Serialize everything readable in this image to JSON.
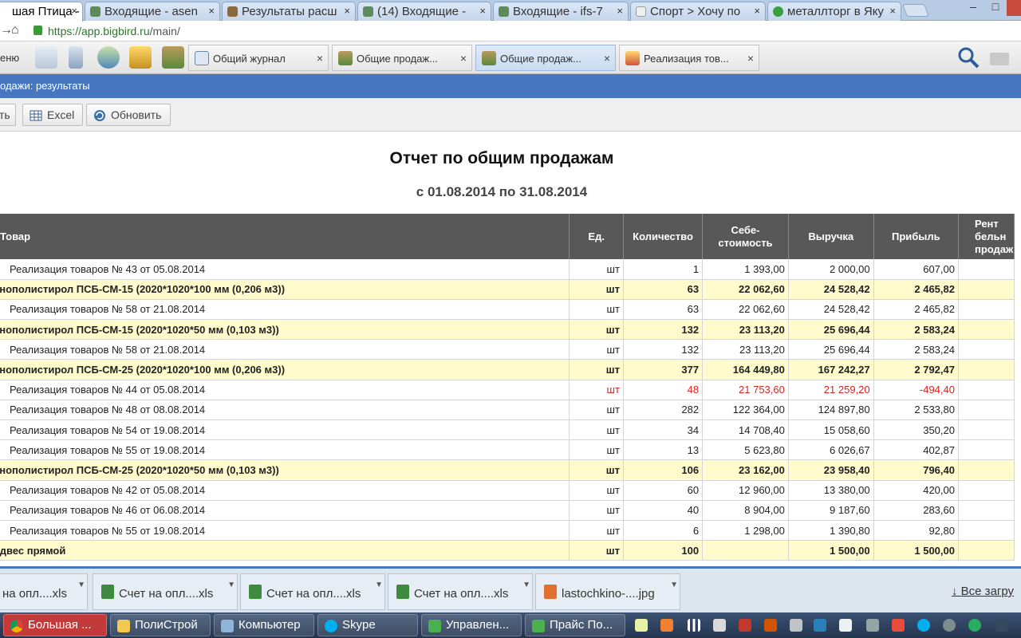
{
  "browser": {
    "tabs": [
      {
        "title": "шая Птица -",
        "active": true
      },
      {
        "title": "Входящие - asen"
      },
      {
        "title": "Результаты расш"
      },
      {
        "title": "(14) Входящие -"
      },
      {
        "title": "Входящие - ifs-7"
      },
      {
        "title": "Спорт > Хочу по"
      },
      {
        "title": "металлторг в Яку"
      }
    ],
    "close_glyph": "×",
    "url_host": "https://app.bigbird.ru",
    "url_path": "/main/"
  },
  "app_toolbar": {
    "menu_label": "еню",
    "tabs": [
      {
        "label": "Общий журнал"
      },
      {
        "label": "Общие продаж..."
      },
      {
        "label": "Общие продаж...",
        "active": true
      },
      {
        "label": "Реализация тов..."
      }
    ],
    "tab_close": "×"
  },
  "breadcrumb": "одажи: результаты",
  "actions": {
    "print": "ть",
    "excel": "Excel",
    "refresh": "Обновить"
  },
  "report": {
    "title": "Отчет по общим продажам",
    "period": "с 01.08.2014 по 31.08.2014",
    "headers": {
      "product": "Товар",
      "unit": "Ед.",
      "qty": "Количество",
      "cost_1": "Себе-",
      "cost_2": "стоимость",
      "revenue": "Выручка",
      "profit": "Прибыль",
      "margin_1": "Рент",
      "margin_2": "бельн",
      "margin_3": "продаж"
    },
    "rows": [
      {
        "name": "Реализация товаров № 43 от 05.08.2014",
        "unit": "шт",
        "qty": "1",
        "cost": "1 393,00",
        "revenue": "2 000,00",
        "profit": "607,00",
        "type": "item"
      },
      {
        "name": "енополистирол ПСБ-СМ-15 (2020*1020*100 мм (0,206 м3))",
        "unit": "шт",
        "qty": "63",
        "cost": "22 062,60",
        "revenue": "24 528,42",
        "profit": "2 465,82",
        "type": "group"
      },
      {
        "name": "Реализация товаров № 58 от 21.08.2014",
        "unit": "шт",
        "qty": "63",
        "cost": "22 062,60",
        "revenue": "24 528,42",
        "profit": "2 465,82",
        "type": "item"
      },
      {
        "name": "енополистирол ПСБ-СМ-15 (2020*1020*50 мм (0,103 м3))",
        "unit": "шт",
        "qty": "132",
        "cost": "23 113,20",
        "revenue": "25 696,44",
        "profit": "2 583,24",
        "type": "group"
      },
      {
        "name": "Реализация товаров № 58 от 21.08.2014",
        "unit": "шт",
        "qty": "132",
        "cost": "23 113,20",
        "revenue": "25 696,44",
        "profit": "2 583,24",
        "type": "item"
      },
      {
        "name": "енополистирол ПСБ-СМ-25 (2020*1020*100 мм (0,206 м3))",
        "unit": "шт",
        "qty": "377",
        "cost": "164 449,80",
        "revenue": "167 242,27",
        "profit": "2 792,47",
        "type": "group"
      },
      {
        "name": "Реализация товаров № 44 от 05.08.2014",
        "unit": "шт",
        "qty": "48",
        "cost": "21 753,60",
        "revenue": "21 259,20",
        "profit": "-494,40",
        "type": "neg"
      },
      {
        "name": "Реализация товаров № 48 от 08.08.2014",
        "unit": "шт",
        "qty": "282",
        "cost": "122 364,00",
        "revenue": "124 897,80",
        "profit": "2 533,80",
        "type": "item"
      },
      {
        "name": "Реализация товаров № 54 от 19.08.2014",
        "unit": "шт",
        "qty": "34",
        "cost": "14 708,40",
        "revenue": "15 058,60",
        "profit": "350,20",
        "type": "item"
      },
      {
        "name": "Реализация товаров № 55 от 19.08.2014",
        "unit": "шт",
        "qty": "13",
        "cost": "5 623,80",
        "revenue": "6 026,67",
        "profit": "402,87",
        "type": "item"
      },
      {
        "name": "енополистирол ПСБ-СМ-25 (2020*1020*50 мм (0,103 м3))",
        "unit": "шт",
        "qty": "106",
        "cost": "23 162,00",
        "revenue": "23 958,40",
        "profit": "796,40",
        "type": "group"
      },
      {
        "name": "Реализация товаров № 42 от 05.08.2014",
        "unit": "шт",
        "qty": "60",
        "cost": "12 960,00",
        "revenue": "13 380,00",
        "profit": "420,00",
        "type": "item"
      },
      {
        "name": "Реализация товаров № 46 от 06.08.2014",
        "unit": "шт",
        "qty": "40",
        "cost": "8 904,00",
        "revenue": "9 187,60",
        "profit": "283,60",
        "type": "item"
      },
      {
        "name": "Реализация товаров № 55 от 19.08.2014",
        "unit": "шт",
        "qty": "6",
        "cost": "1 298,00",
        "revenue": "1 390,80",
        "profit": "92,80",
        "type": "item"
      },
      {
        "name": "одвес прямой",
        "unit": "шт",
        "qty": "100",
        "cost": "",
        "revenue": "1 500,00",
        "profit": "1 500,00",
        "type": "group"
      }
    ]
  },
  "downloads": {
    "items": [
      {
        "label": "на опл....xls"
      },
      {
        "label": "Счет на опл....xls"
      },
      {
        "label": "Счет на опл....xls"
      },
      {
        "label": "Счет на опл....xls"
      },
      {
        "label": "lastochkino-....jpg"
      }
    ],
    "all_label": "Все загру"
  },
  "taskbar": {
    "items": [
      {
        "label": "Большая ...",
        "active": true
      },
      {
        "label": "ПолиСтрой"
      },
      {
        "label": "Компьютер"
      },
      {
        "label": "Skype"
      },
      {
        "label": "Управлен..."
      },
      {
        "label": "Прайс По..."
      }
    ]
  },
  "colors": {
    "accent_blue": "#4677c0",
    "group_row": "#fffbcc",
    "negative": "#e02020",
    "header_dark": "#585858"
  }
}
